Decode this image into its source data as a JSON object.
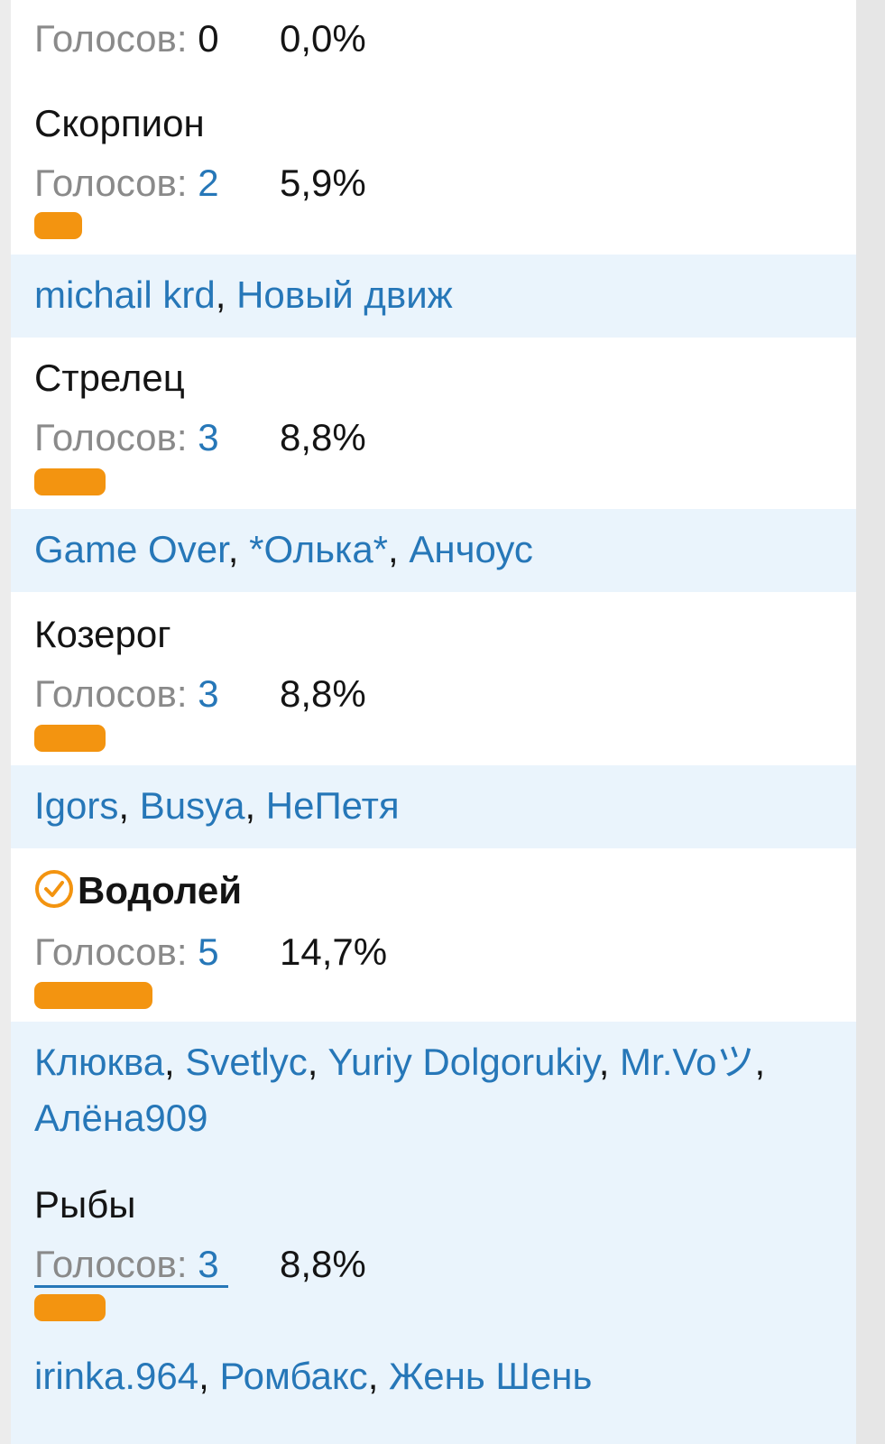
{
  "vote_label": "Голосов:",
  "options": [
    {
      "title": "",
      "votes": "0",
      "percent": "0,0%",
      "voters": []
    },
    {
      "title": "Скорпион",
      "votes": "2",
      "percent": "5,9%",
      "share": 0.059,
      "voters": [
        "michail krd",
        "Новый движ"
      ]
    },
    {
      "title": "Стрелец",
      "votes": "3",
      "percent": "8,8%",
      "share": 0.088,
      "voters": [
        "Game Over",
        "*Олька*",
        "Анчоус"
      ]
    },
    {
      "title": "Козерог",
      "votes": "3",
      "percent": "8,8%",
      "share": 0.088,
      "voters": [
        "Igors",
        "Busya",
        "НеПетя"
      ]
    },
    {
      "title": "Водолей",
      "votes": "5",
      "percent": "14,7%",
      "share": 0.147,
      "selected": true,
      "voters": [
        "Клюква",
        "Svetlyc",
        "Yuriy Dolgorukiy",
        "Mr.Voツ",
        "Алёна909"
      ]
    },
    {
      "title": "Рыбы",
      "votes": "3",
      "percent": "8,8%",
      "share": 0.088,
      "voters": [
        "irinka.964",
        "Ромбакс",
        "Жень Шень"
      ]
    }
  ],
  "colors": {
    "bar": "#f39410",
    "link": "#2677b8",
    "voters_bg": "#eaf4fc",
    "check": "#f39410"
  },
  "icons": {
    "selected": "check-circle-icon"
  }
}
